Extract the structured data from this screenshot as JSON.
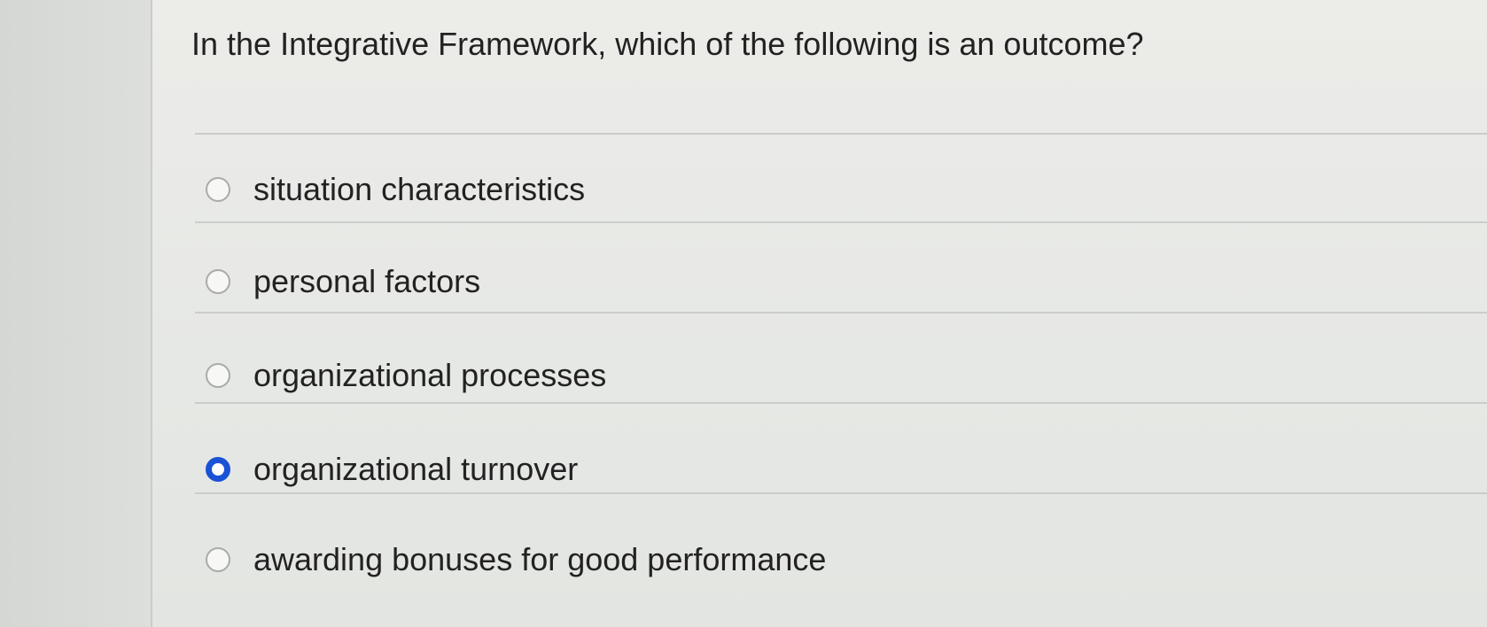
{
  "question": {
    "text": "In the Integrative Framework, which of the following is an outcome?"
  },
  "options": [
    {
      "label": "situation characteristics",
      "selected": false
    },
    {
      "label": "personal factors",
      "selected": false
    },
    {
      "label": "organizational processes",
      "selected": false
    },
    {
      "label": "organizational turnover",
      "selected": true
    },
    {
      "label": "awarding bonuses for good performance",
      "selected": false
    }
  ],
  "colors": {
    "selected_radio": "#1a52d6",
    "page_background": "#ecece9",
    "text": "#222222"
  }
}
